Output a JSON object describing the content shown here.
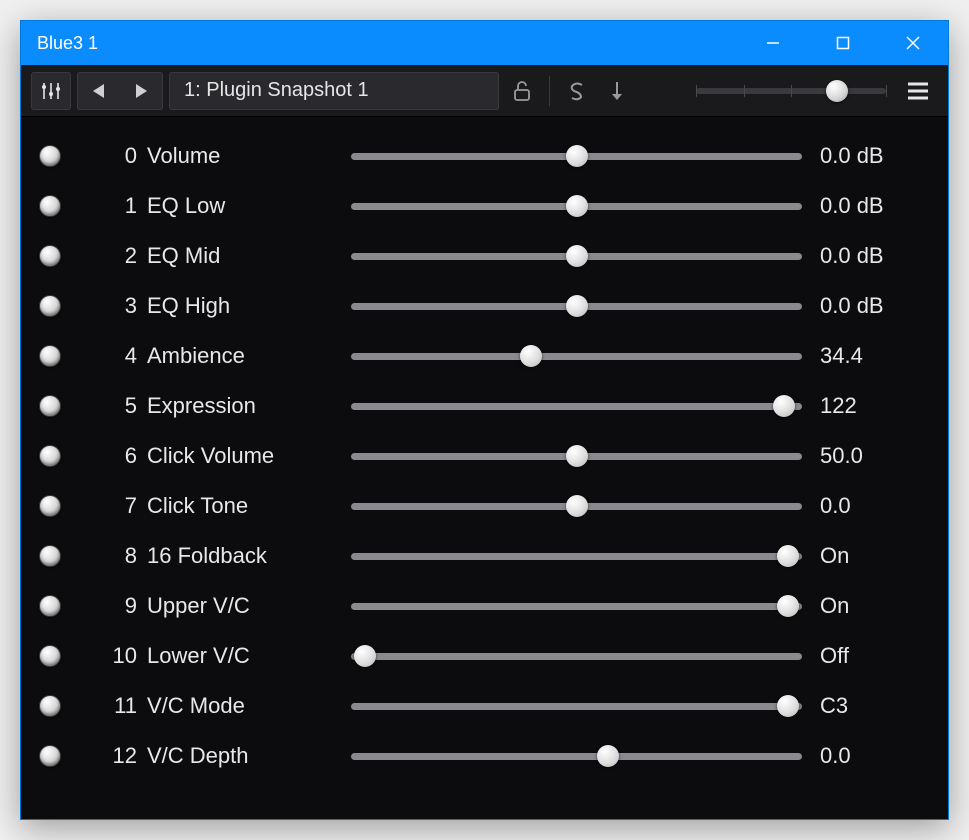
{
  "window": {
    "title": "Blue3 1"
  },
  "toolbar": {
    "preset_label": "1: Plugin Snapshot 1",
    "main_slider_pos": 0.74
  },
  "params": [
    {
      "index": "0",
      "name": "Volume",
      "pos": 0.5,
      "value": "0.0 dB"
    },
    {
      "index": "1",
      "name": "EQ Low",
      "pos": 0.5,
      "value": "0.0 dB"
    },
    {
      "index": "2",
      "name": "EQ Mid",
      "pos": 0.5,
      "value": "0.0 dB"
    },
    {
      "index": "3",
      "name": "EQ High",
      "pos": 0.5,
      "value": "0.0 dB"
    },
    {
      "index": "4",
      "name": "Ambience",
      "pos": 0.4,
      "value": "34.4"
    },
    {
      "index": "5",
      "name": "Expression",
      "pos": 0.96,
      "value": "122"
    },
    {
      "index": "6",
      "name": "Click Volume",
      "pos": 0.5,
      "value": "50.0"
    },
    {
      "index": "7",
      "name": "Click Tone",
      "pos": 0.5,
      "value": "0.0"
    },
    {
      "index": "8",
      "name": "16 Foldback",
      "pos": 0.97,
      "value": "On"
    },
    {
      "index": "9",
      "name": "Upper V/C",
      "pos": 0.97,
      "value": "On"
    },
    {
      "index": "10",
      "name": "Lower V/C",
      "pos": 0.03,
      "value": "Off"
    },
    {
      "index": "11",
      "name": "V/C Mode",
      "pos": 0.97,
      "value": "C3"
    },
    {
      "index": "12",
      "name": "V/C Depth",
      "pos": 0.57,
      "value": "0.0"
    }
  ]
}
